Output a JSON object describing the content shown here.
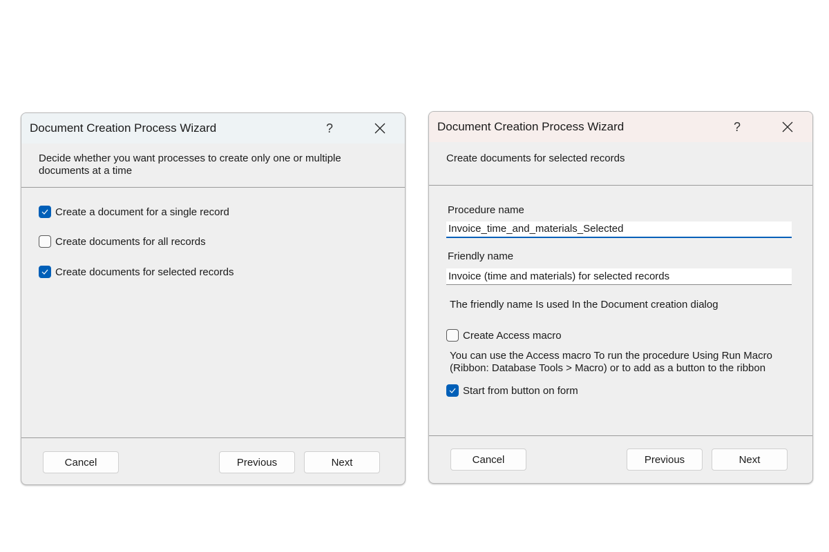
{
  "dialog1": {
    "title": "Document Creation Process Wizard",
    "help_label": "?",
    "header_text": "Decide whether you want processes to create only one or multiple documents at a time",
    "options": [
      {
        "label": "Create a document for a single record",
        "checked": true
      },
      {
        "label": "Create documents for all records",
        "checked": false
      },
      {
        "label": "Create documents for selected records",
        "checked": true
      }
    ],
    "buttons": {
      "cancel": "Cancel",
      "previous": "Previous",
      "next": "Next"
    }
  },
  "dialog2": {
    "title": "Document Creation Process Wizard",
    "help_label": "?",
    "header_text": "Create documents for selected records",
    "procedure_name": {
      "label": "Procedure name",
      "value": "Invoice_time_and_materials_Selected"
    },
    "friendly_name": {
      "label": "Friendly name",
      "value": "Invoice (time and materials) for selected records"
    },
    "friendly_note": "The friendly name Is used In the Document creation dialog",
    "create_macro": {
      "label": "Create Access macro",
      "checked": false
    },
    "macro_note": "You can use the Access macro To run the procedure Using Run Macro (Ribbon: Database Tools > Macro) or to add as a button to the ribbon",
    "start_from_button": {
      "label": "Start from button on form",
      "checked": true
    },
    "buttons": {
      "cancel": "Cancel",
      "previous": "Previous",
      "next": "Next"
    }
  },
  "colors": {
    "accent": "#005fb8",
    "dialog_bg": "#efefef"
  }
}
